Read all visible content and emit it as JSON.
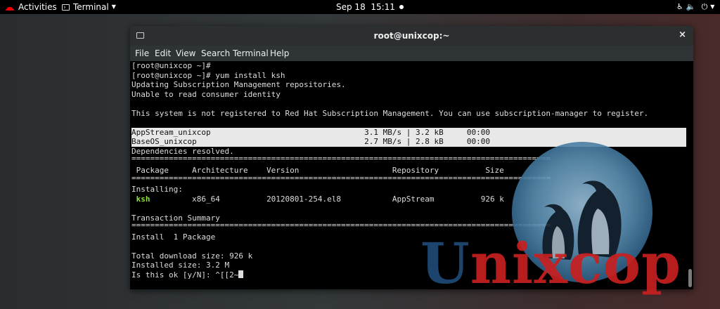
{
  "topbar": {
    "activities": "Activities",
    "app_menu": "Terminal",
    "clock": "Sep 18  15:11",
    "icons": [
      "redhat-icon",
      "terminal-icon",
      "recording-dot-icon",
      "accessibility-icon",
      "volume-icon",
      "power-icon"
    ]
  },
  "window": {
    "title": "root@unixcop:~",
    "close": "×",
    "menu": [
      "File",
      "Edit",
      "View",
      "Search",
      "Terminal",
      "Help"
    ]
  },
  "terminal": {
    "lines": [
      "[root@unixcop ~]#",
      "[root@unixcop ~]# yum install ksh",
      "Updating Subscription Management repositories.",
      "Unable to read consumer identity",
      "",
      "This system is not registered to Red Hat Subscription Management. You can use subscription-manager to register.",
      "",
      "AppStream_unixcop                                 3.1 MB/s | 3.2 kB     00:00",
      "BaseOS_unixcop                                    2.7 MB/s | 2.8 kB     00:00",
      "Dependencies resolved.",
      "==========================================================================================",
      " Package     Architecture    Version                    Repository          Size",
      "==========================================================================================",
      "Installing:",
      " ksh         x86_64          20120801-254.el8           AppStream          926 k",
      "",
      "Transaction Summary",
      "==========================================================================================",
      "Install  1 Package",
      "",
      "Total download size: 926 k",
      "Installed size: 3.2 M",
      "Is this ok [y/N]: ^[[2~"
    ],
    "ksh_rest": "         x86_64          20120801-254.el8           AppStream          926 k",
    "ksh_name": "ksh"
  },
  "watermark": {
    "text_first": "U",
    "text_rest": "nixcop"
  },
  "colors": {
    "terminal_bg": "#000000",
    "ksh_green": "#8ae234",
    "highlight_bg": "#e8e8e8",
    "watermark_red": "#c82020",
    "watermark_blue": "#1f4a77"
  }
}
